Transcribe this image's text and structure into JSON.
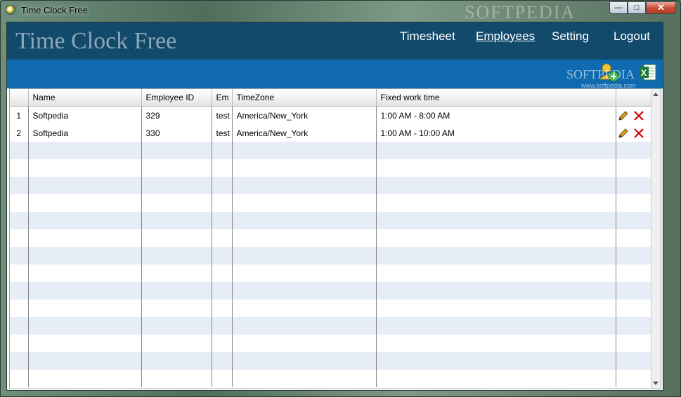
{
  "window": {
    "title": "Time Clock Free",
    "watermark": "SOFTPEDIA",
    "watermark_small": "SOFTPEDIA",
    "watermark_url": "www.softpedia.com"
  },
  "header": {
    "brand": "Time Clock Free",
    "nav": [
      {
        "label": "Timesheet",
        "active": false
      },
      {
        "label": "Employees",
        "active": true
      },
      {
        "label": "Setting",
        "active": false
      },
      {
        "label": "Logout",
        "active": false
      }
    ]
  },
  "toolbar": {
    "add_icon": "add-user-icon",
    "export_icon": "excel-export-icon"
  },
  "table": {
    "columns": [
      "",
      "Name",
      "Employee ID",
      "Em",
      "TimeZone",
      "Fixed work time",
      ""
    ],
    "rows": [
      {
        "idx": "1",
        "name": "Softpedia",
        "employee_id": "329",
        "em": "test",
        "timezone": "America/New_York",
        "fixed_time": "1:00 AM - 8:00 AM"
      },
      {
        "idx": "2",
        "name": "Softpedia",
        "employee_id": "330",
        "em": "test",
        "timezone": "America/New_York",
        "fixed_time": "1:00 AM - 10:00 AM"
      }
    ],
    "empty_rows": 14
  },
  "colors": {
    "header_bg": "#124a6c",
    "toolbar_bg": "#0f6ab0",
    "row_alt": "#e6edf6",
    "delete": "#cc0000"
  }
}
